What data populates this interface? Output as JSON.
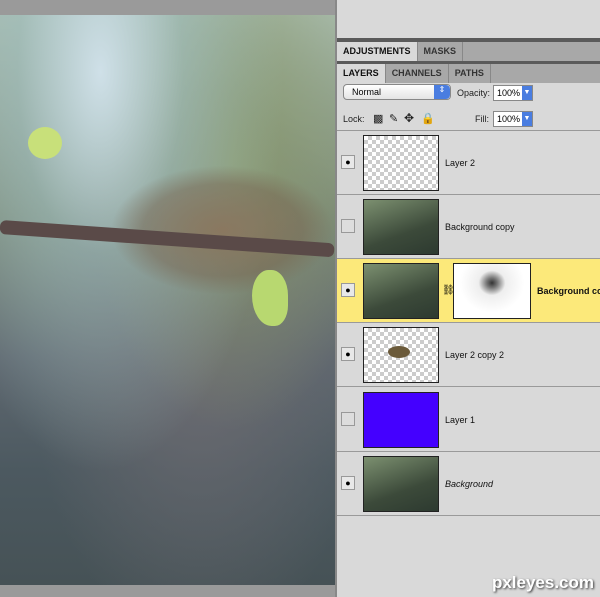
{
  "panel": {
    "tabs_top": [
      "ADJUSTMENTS",
      "MASKS"
    ],
    "tabs": [
      "LAYERS",
      "CHANNELS",
      "PATHS"
    ],
    "blend_mode": "Normal",
    "opacity_label": "Opacity:",
    "opacity": "100%",
    "lock_label": "Lock:",
    "fill_label": "Fill:",
    "fill": "100%"
  },
  "layers": [
    {
      "name": "Layer 2",
      "visible": true,
      "thumb": "transparent"
    },
    {
      "name": "Background copy",
      "visible": false,
      "thumb": "photo"
    },
    {
      "name": "Background co",
      "visible": true,
      "thumb": "photo",
      "mask": true,
      "selected": true
    },
    {
      "name": "Layer 2 copy 2",
      "visible": true,
      "thumb": "transparent-bird"
    },
    {
      "name": "Layer 1",
      "visible": false,
      "thumb": "solid",
      "color": "#4400ff"
    },
    {
      "name": "Background",
      "visible": true,
      "thumb": "photo",
      "italic": true
    }
  ],
  "colors": {
    "selected_row": "#fce97a",
    "layer1_fill": "#4400ff"
  },
  "watermark": "pxleyes.com"
}
